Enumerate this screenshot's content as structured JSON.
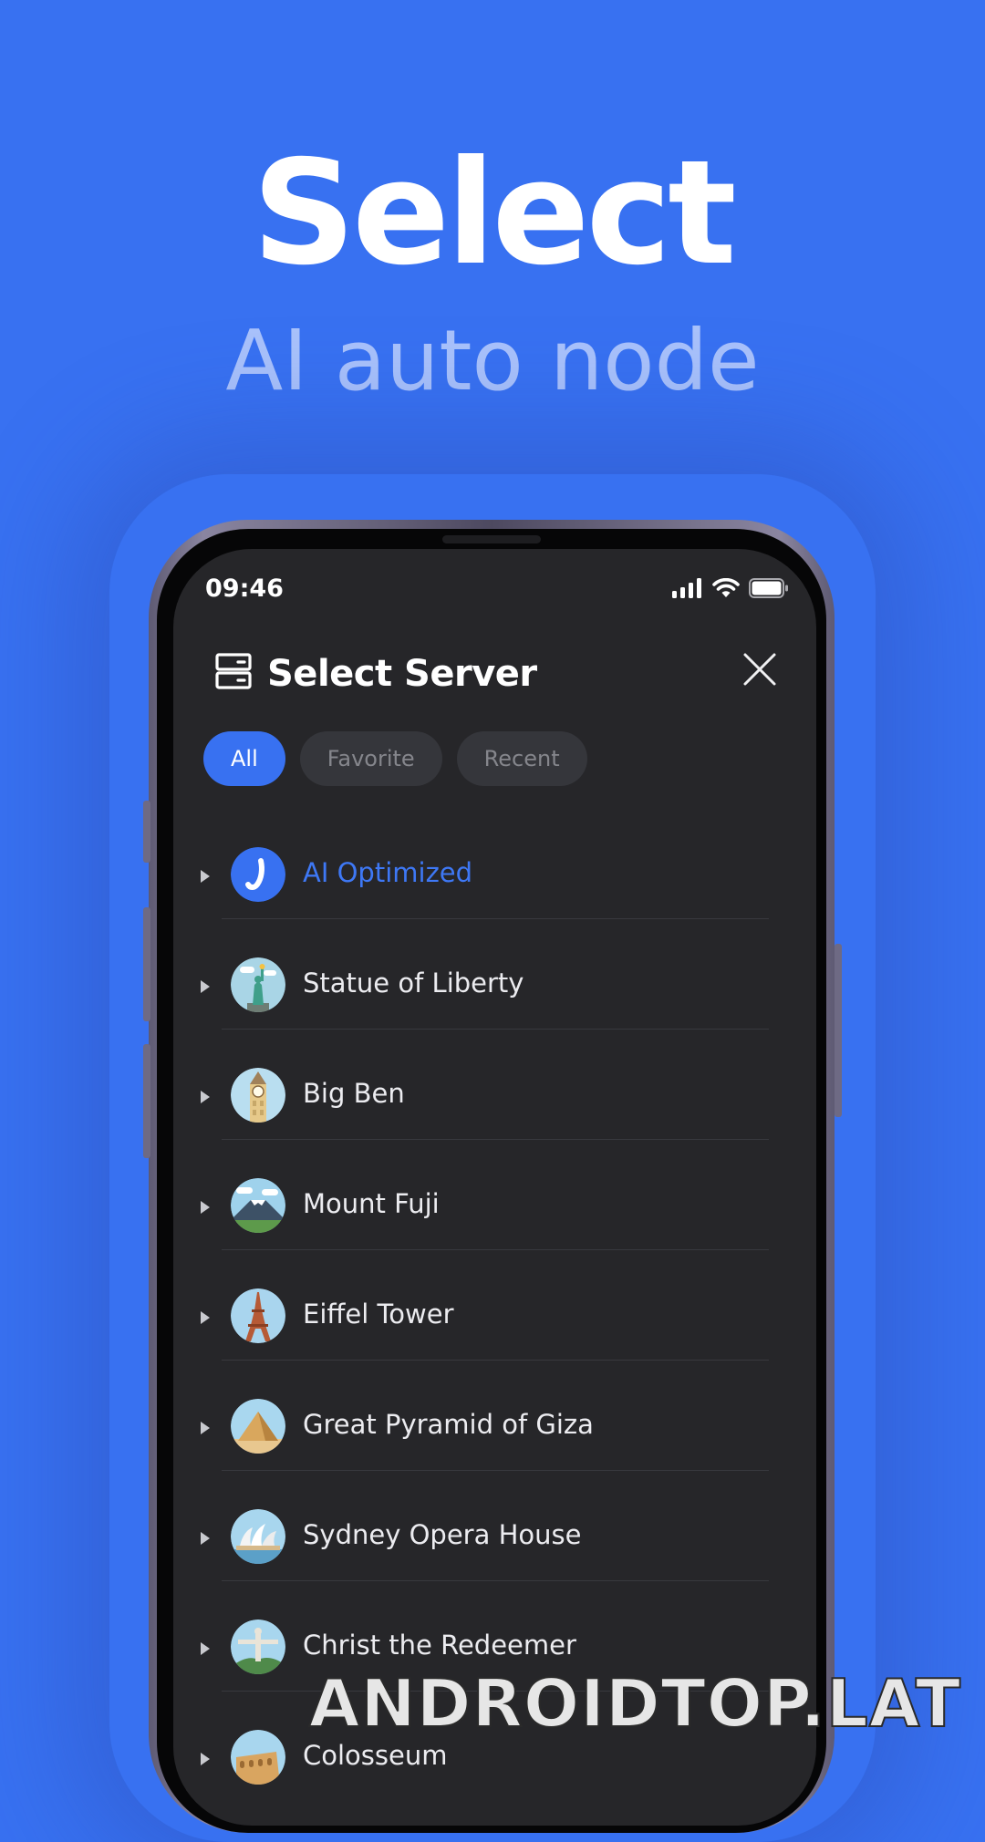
{
  "headline": {
    "title": "Select",
    "subtitle": "AI auto node"
  },
  "status_bar": {
    "time": "09:46",
    "icons": [
      "signal-icon",
      "wifi-icon",
      "battery-icon"
    ]
  },
  "dialog": {
    "title": "Select Server",
    "header_icon": "server-icon",
    "close_icon": "close-icon"
  },
  "tabs": [
    {
      "label": "All",
      "active": true
    },
    {
      "label": "Favorite",
      "active": false
    },
    {
      "label": "Recent",
      "active": false
    }
  ],
  "servers": [
    {
      "label": "AI Optimized",
      "icon": "ai-logo-icon",
      "active": true
    },
    {
      "label": "Statue of Liberty",
      "icon": "statue-of-liberty-icon",
      "active": false
    },
    {
      "label": "Big Ben",
      "icon": "big-ben-icon",
      "active": false
    },
    {
      "label": "Mount Fuji",
      "icon": "mount-fuji-icon",
      "active": false
    },
    {
      "label": "Eiffel Tower",
      "icon": "eiffel-tower-icon",
      "active": false
    },
    {
      "label": "Great Pyramid of Giza",
      "icon": "pyramid-icon",
      "active": false
    },
    {
      "label": "Sydney Opera House",
      "icon": "opera-house-icon",
      "active": false
    },
    {
      "label": "Christ the Redeemer",
      "icon": "christ-redeemer-icon",
      "active": false
    },
    {
      "label": "Colosseum",
      "icon": "colosseum-icon",
      "active": false
    }
  ],
  "watermark": "ANDROIDTOP.LAT",
  "colors": {
    "background": "#3871f1",
    "accent": "#3871f1",
    "screen": "#262629",
    "subtitle": "#a9c2fb",
    "active_label": "#3e78f5"
  }
}
